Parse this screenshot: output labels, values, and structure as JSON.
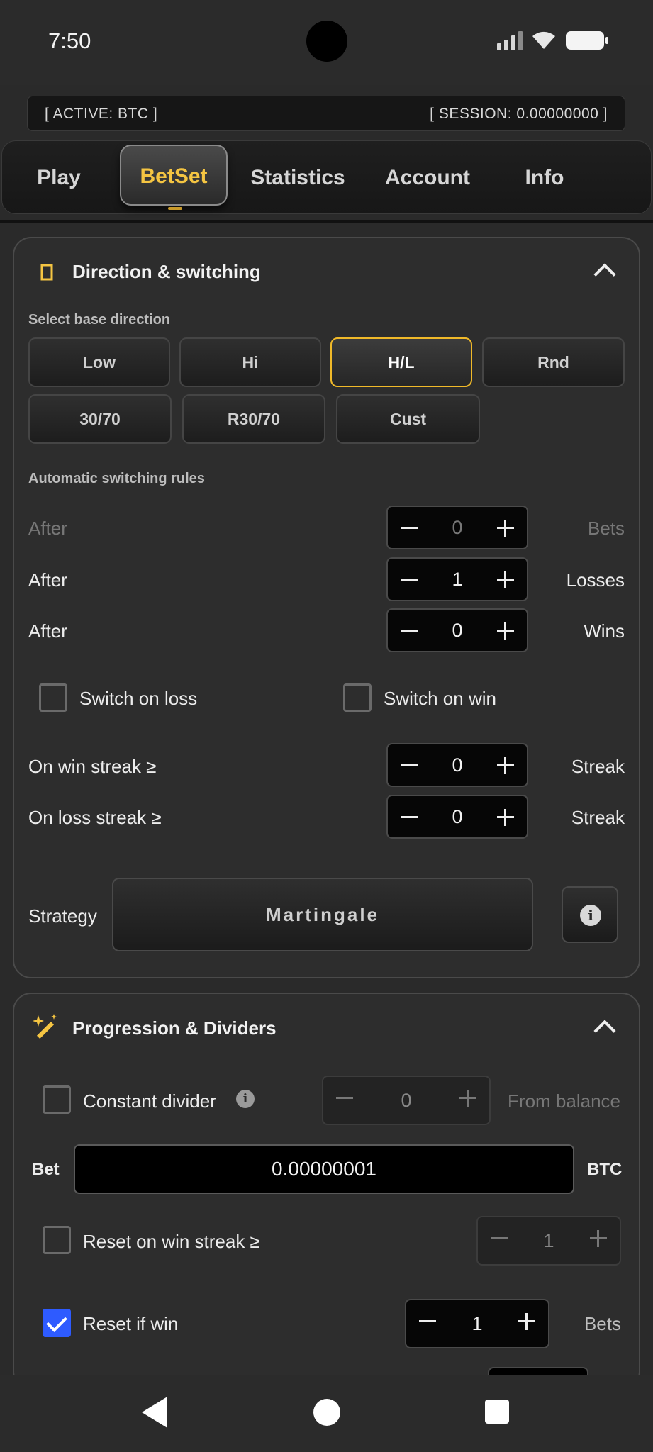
{
  "status": {
    "time": "7:50"
  },
  "session": {
    "active": "[ ACTIVE: BTC ]",
    "session": "[ SESSION: 0.00000000 ]"
  },
  "tabs": [
    {
      "label": "Play"
    },
    {
      "label": "BetSet"
    },
    {
      "label": "Statistics"
    },
    {
      "label": "Account"
    },
    {
      "label": "Info"
    }
  ],
  "direction": {
    "title": "Direction & switching",
    "base_label": "Select base direction",
    "buttons": [
      "Low",
      "Hi",
      "H/L",
      "Rnd",
      "30/70",
      "R30/70",
      "Cust"
    ],
    "selected": "H/L",
    "auto_label": "Automatic switching rules",
    "rules": [
      {
        "label": "After",
        "value": "0",
        "unit": "Bets"
      },
      {
        "label": "After",
        "value": "1",
        "unit": "Losses"
      },
      {
        "label": "After",
        "value": "0",
        "unit": "Wins"
      }
    ],
    "switch_on_loss": "Switch on loss",
    "switch_on_win": "Switch on win",
    "streaks": [
      {
        "label": "On win streak ≥",
        "value": "0",
        "unit": "Streak"
      },
      {
        "label": "On loss streak ≥",
        "value": "0",
        "unit": "Streak"
      }
    ],
    "strategy_label": "Strategy",
    "strategy_value": "Martingale"
  },
  "progression": {
    "title": "Progression & Dividers",
    "constant_divider": "Constant divider",
    "divider_value": "0",
    "from_balance": "From balance",
    "bet_label": "Bet",
    "bet_value": "0.00000001",
    "bet_currency": "BTC",
    "reset_win_streak": "Reset on win streak ≥",
    "reset_win_streak_value": "1",
    "reset_if_win": "Reset if win",
    "reset_if_win_value": "1",
    "reset_if_win_unit": "Bets"
  },
  "colors": {
    "accent": "#f5c542",
    "selected_border": "#f0b929",
    "checkbox_on": "#2e5bff"
  }
}
